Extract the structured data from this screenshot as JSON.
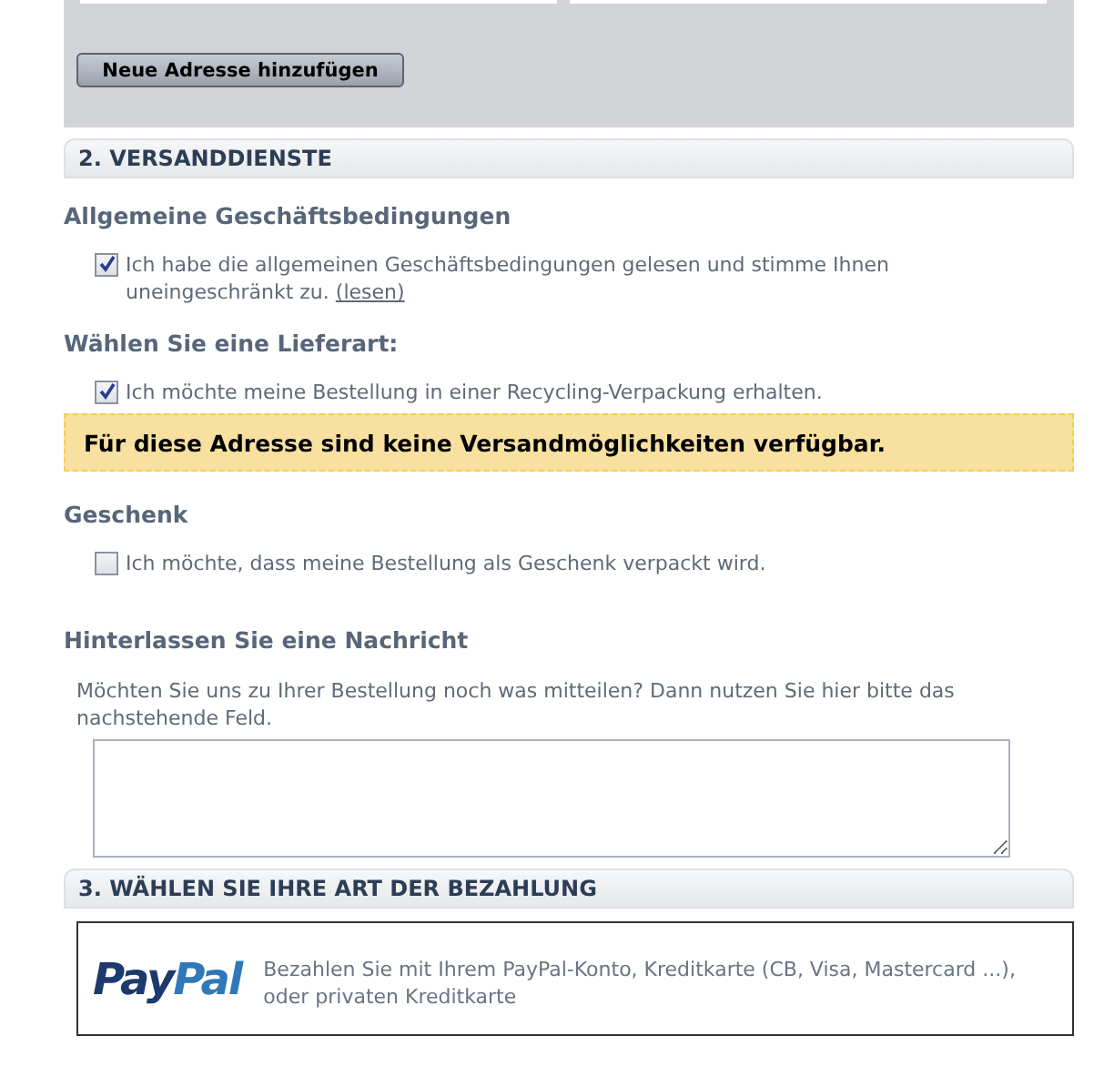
{
  "address_panel": {
    "button": "Neue Adresse hinzufügen"
  },
  "shipping": {
    "title": "2. VERSANDDIENSTE",
    "terms": {
      "heading": "Allgemeine Geschäftsbedingungen",
      "checkbox": {
        "label": "Ich habe die allgemeinen Geschäftsbedingungen gelesen und stimme Ihnen uneingeschränkt zu.",
        "link": "(lesen)",
        "checked": true
      }
    },
    "delivery": {
      "heading": "Wählen Sie eine Lieferart:",
      "checkbox": {
        "label": "Ich möchte meine Bestellung in einer Recycling-Verpackung erhalten.",
        "checked": true
      }
    },
    "notice": "Für diese Adresse sind keine Versandmöglichkeiten verfügbar.",
    "gift": {
      "heading": "Geschenk",
      "checkbox": {
        "label": "Ich möchte, dass meine Bestellung als Geschenk verpackt wird.",
        "checked": false
      }
    },
    "message": {
      "heading": "Hinterlassen Sie eine Nachricht",
      "description": "Möchten Sie uns zu Ihrer Bestellung noch was mitteilen? Dann nutzen Sie hier bitte das nachstehende Feld."
    }
  },
  "payment": {
    "title": "3. WÄHLEN SIE IHRE ART DER BEZAHLUNG",
    "option": {
      "logo": [
        "Pay",
        "Pal"
      ],
      "description": "Bezahlen Sie mit Ihrem PayPal-Konto, Kreditkarte (CB, Visa, Mastercard ...), oder privaten Kreditkarte"
    }
  }
}
